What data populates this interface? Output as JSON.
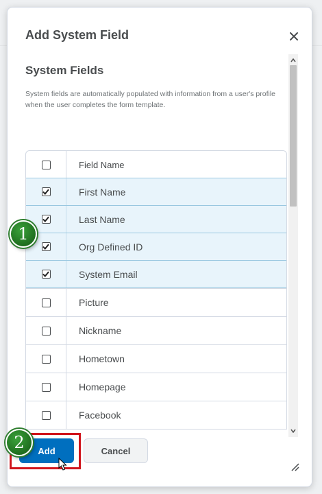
{
  "dialog": {
    "title": "Add System Field",
    "section_heading": "System Fields",
    "description": "System fields are automatically populated with information from a user's profile when the user completes the form template."
  },
  "table": {
    "header": "Field Name",
    "rows": [
      {
        "label": "First Name",
        "checked": true
      },
      {
        "label": "Last Name",
        "checked": true
      },
      {
        "label": "Org Defined ID",
        "checked": true
      },
      {
        "label": "System Email",
        "checked": true
      },
      {
        "label": "Picture",
        "checked": false
      },
      {
        "label": "Nickname",
        "checked": false
      },
      {
        "label": "Hometown",
        "checked": false
      },
      {
        "label": "Homepage",
        "checked": false
      },
      {
        "label": "Facebook",
        "checked": false
      }
    ]
  },
  "buttons": {
    "add": "Add",
    "cancel": "Cancel"
  },
  "annotations": {
    "step1": "1",
    "step2": "2"
  },
  "icons": {
    "close": "close-icon",
    "check": "check-icon",
    "resize": "resize-handle-icon",
    "cursor": "hand-cursor-icon"
  },
  "colors": {
    "primary": "#006fbf",
    "selected_row": "#e8f4fb",
    "highlight": "#d0151c",
    "badge": "#2d7d2d"
  }
}
